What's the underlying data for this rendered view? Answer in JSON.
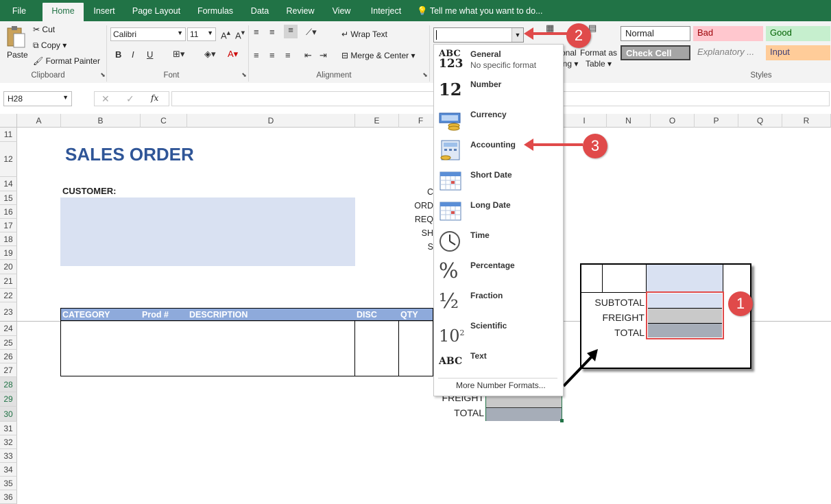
{
  "tabs": [
    "File",
    "Home",
    "Insert",
    "Page Layout",
    "Formulas",
    "Data",
    "Review",
    "View",
    "Interject"
  ],
  "tell_me": "Tell me what you want to do...",
  "clipboard": {
    "paste": "Paste",
    "cut": "Cut",
    "copy": "Copy",
    "format_painter": "Format Painter",
    "label": "Clipboard"
  },
  "font": {
    "name": "Calibri",
    "size": "11",
    "label": "Font",
    "bold": "B",
    "italic": "I",
    "underline": "U"
  },
  "alignment": {
    "wrap_text": "Wrap Text",
    "merge_center": "Merge & Center",
    "label": "Alignment"
  },
  "number_format": {
    "value": ""
  },
  "cond_format": {
    "line1": "onal",
    "line2": "ing"
  },
  "format_table": {
    "line1": "Format as",
    "line2": "Table"
  },
  "styles": {
    "label": "Styles",
    "normal": "Normal",
    "bad": "Bad",
    "good": "Good",
    "check_cell": "Check Cell",
    "explanatory": "Explanatory ...",
    "input": "Input"
  },
  "name_box": "H28",
  "formula_fx": "fx",
  "columns": [
    "A",
    "B",
    "C",
    "D",
    "E",
    "F",
    "I",
    "N",
    "O",
    "P",
    "Q",
    "R"
  ],
  "rows": [
    "11",
    "12",
    "14",
    "15",
    "16",
    "17",
    "18",
    "19",
    "20",
    "21",
    "22",
    "23",
    "24",
    "25",
    "26",
    "27",
    "28",
    "29",
    "30",
    "31",
    "32",
    "33",
    "34",
    "35",
    "36"
  ],
  "sheet": {
    "title": "SALES ORDER",
    "customer": "CUSTOMER:",
    "left_labels": [
      "C",
      "ORD",
      "REQ",
      "SH",
      "S"
    ],
    "headers": [
      "CATEGORY",
      "Prod #",
      "DESCRIPTION",
      "DISC",
      "QTY"
    ],
    "totals": [
      "FREIGHT",
      "TOTAL"
    ]
  },
  "dropdown": {
    "items": [
      {
        "name": "General",
        "sub": "No specific format",
        "icon": "general-icon"
      },
      {
        "name": "Number",
        "sub": "",
        "icon": "number-icon"
      },
      {
        "name": "Currency",
        "sub": "",
        "icon": "currency-icon"
      },
      {
        "name": "Accounting",
        "sub": "",
        "icon": "accounting-icon"
      },
      {
        "name": "Short Date",
        "sub": "",
        "icon": "short-date-icon"
      },
      {
        "name": "Long Date",
        "sub": "",
        "icon": "long-date-icon"
      },
      {
        "name": "Time",
        "sub": "",
        "icon": "time-icon"
      },
      {
        "name": "Percentage",
        "sub": "",
        "icon": "percentage-icon"
      },
      {
        "name": "Fraction",
        "sub": "",
        "icon": "fraction-icon"
      },
      {
        "name": "Scientific",
        "sub": "",
        "icon": "scientific-icon"
      },
      {
        "name": "Text",
        "sub": "",
        "icon": "text-icon"
      }
    ],
    "more": "More Number Formats..."
  },
  "icon_glyphs": {
    "general_top": "ABC",
    "general_bottom": "123",
    "number": "12",
    "percentage": "%",
    "fraction": "½",
    "scientific_base": "10",
    "scientific_exp": "2",
    "text": "ABC"
  },
  "zoom_box": {
    "labels": [
      "SUBTOTAL",
      "FREIGHT",
      "TOTAL"
    ]
  },
  "callouts": [
    "1",
    "2",
    "3"
  ],
  "colors": {
    "excel_green": "#217346",
    "accent_red": "#e04a4a",
    "cell_blue": "#d9e1f2",
    "header_blue": "#8eaadb"
  }
}
